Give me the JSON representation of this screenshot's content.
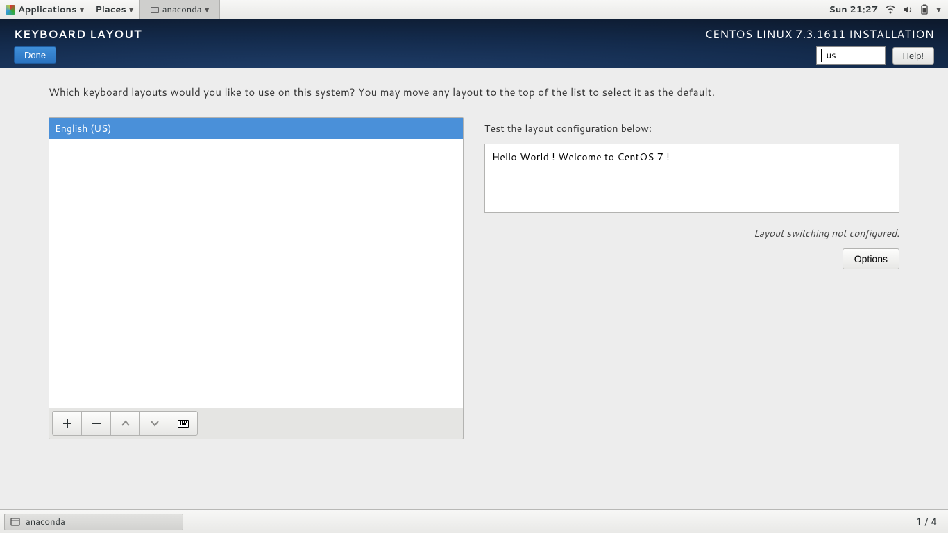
{
  "panel": {
    "applications": "Applications",
    "places": "Places",
    "active_app": "anaconda",
    "clock": "Sun 21:27"
  },
  "header": {
    "title": "KEYBOARD LAYOUT",
    "done": "Done",
    "distro": "CENTOS LINUX 7.3.1611 INSTALLATION",
    "kb_indicator": "us",
    "help": "Help!"
  },
  "main": {
    "prompt": "Which keyboard layouts would you like to use on this system?  You may move any layout to the top of the list to select it as the default.",
    "layouts": [
      {
        "name": "English (US)",
        "selected": true
      }
    ],
    "test_label": "Test the layout configuration below:",
    "test_value": "Hello World ! Welcome to CentOS 7 !",
    "switch_note": "Layout switching not configured.",
    "options": "Options"
  },
  "bottom": {
    "task": "anaconda",
    "workspace": "1 / 4"
  }
}
